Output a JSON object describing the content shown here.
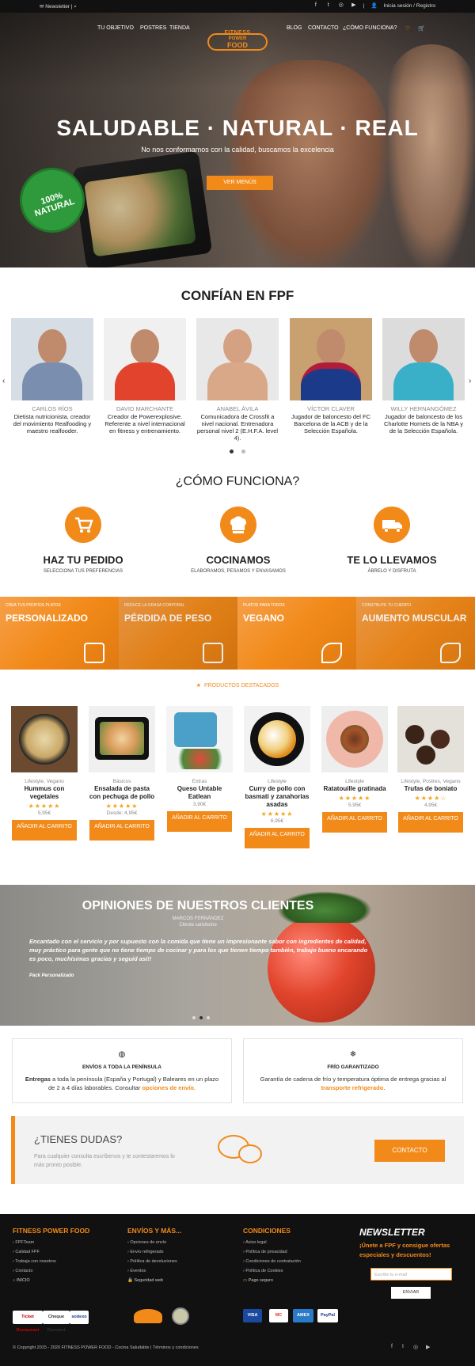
{
  "topbar": {
    "newsletter": "Newsletter",
    "account": "Inicia sesión / Registro",
    "social": [
      "f",
      "t",
      "ig",
      "yt"
    ]
  },
  "nav": {
    "left": [
      "TU OBJETIVO",
      "POSTRES",
      "TIENDA"
    ],
    "right": [
      "BLOG",
      "CONTACTO",
      "¿CÓMO FUNCIONA?"
    ],
    "logo_line1": "FITNESS",
    "logo_line2": "POWER",
    "logo_line3": "FOOD"
  },
  "hero": {
    "title": "SALUDABLE · NATURAL · REAL",
    "subtitle": "No nos conformamos con la calidad, buscamos la excelencia",
    "button": "VER MENÚS",
    "seal": "100% NATURAL"
  },
  "confian": {
    "title": "CONFÍAN EN FPF",
    "people": [
      {
        "name": "CARLOS RÍOS",
        "desc": "Dietista nutricionista, creador del movimiento Realfooding y maestro realfooder."
      },
      {
        "name": "DAVID MARCHANTE",
        "desc": "Creador de Powerexplosive. Referente a nivel internacional en fitness y entrenamiento."
      },
      {
        "name": "ANABEL ÁVILA",
        "desc": "Comunicadora de Crossfit a nivel nacional. Entrenadora personal nivel 2 (E.H.F.A. level 4)."
      },
      {
        "name": "VÍCTOR CLAVER",
        "desc": "Jugador de baloncesto del FC Barcelona de la ACB y de la Selección Española."
      },
      {
        "name": "WILLY HERNANGÓMEZ",
        "desc": "Jugador de baloncesto de los Charlotte Hornets de la NBA y de la Selección Española."
      }
    ]
  },
  "como": {
    "title": "¿CÓMO FUNCIONA?",
    "steps": [
      {
        "title": "HAZ TU PEDIDO",
        "sub": "SELECCIONA TUS PREFERENCIAS",
        "icon": "cart-icon"
      },
      {
        "title": "COCINAMOS",
        "sub": "ELABORAMOS, PESAMOS Y ENVASAMOS",
        "icon": "chef-hat-icon"
      },
      {
        "title": "TE LO LLEVAMOS",
        "sub": "ÁBRELO Y DISFRUTA",
        "icon": "truck-icon"
      }
    ]
  },
  "banners": [
    {
      "small": "CREA TUS PROPIOS PLATOS",
      "big": "PERSONALIZADO"
    },
    {
      "small": "REDUCE LA GRASA CORPORAL",
      "big": "PÉRDIDA DE PESO"
    },
    {
      "small": "PLATOS PARA TODOS",
      "big": "VEGANO"
    },
    {
      "small": "CONSTRUYE TU CUERPO",
      "big": "AUMENTO MUSCULAR"
    }
  ],
  "productos": {
    "title": "PRODUCTOS DESTACADOS",
    "items": [
      {
        "cat": "Lifestyle, Vegano",
        "name": "Hummus con vegetales",
        "stars": "★★★★★",
        "price": "5,95€",
        "cart": "AÑADIR AL CARRITO"
      },
      {
        "cat": "Básicos",
        "name": "Ensalada de pasta con pechuga de pollo",
        "stars": "★★★★★",
        "price": "Desde: 4,95€",
        "cart": "AÑADIR AL CARRITO"
      },
      {
        "cat": "Extras",
        "name": "Queso Untable Eatlean",
        "stars": "",
        "price": "3,90€",
        "cart": "AÑADIR AL CARRITO"
      },
      {
        "cat": "Lifestyle",
        "name": "Curry de pollo con basmati y zanahorias asadas",
        "stars": "★★★★★",
        "price": "6,95€",
        "cart": "AÑADIR AL CARRITO"
      },
      {
        "cat": "Lifestyle",
        "name": "Ratatouille gratinada",
        "stars": "★★★★★",
        "price": "5,95€",
        "cart": "AÑADIR AL CARRITO"
      },
      {
        "cat": "Lifestyle, Postres, Vegano",
        "name": "Trufas de boniato",
        "stars": "★★★★☆",
        "price": "4,95€",
        "cart": "AÑADIR AL CARRITO"
      }
    ]
  },
  "opiniones": {
    "title": "OPINIONES DE NUESTROS CLIENTES",
    "author": "MARCOS FERNÁNDEZ",
    "role": "Cliente satisfecho",
    "quote": "Encantado con el servicio y por supuesto con la comida que tiene un impresionante sabor con ingredientes de calidad, muy práctico para gente que no tiene tiempo de cocinar y para los que tienen tiempo también, trabajo bueno encarando es poco, muchísimas gracias y seguid así!!",
    "pack": "Pack Personalizado"
  },
  "info": [
    {
      "icon": "globe-icon",
      "title": "ENVÍOS A TODA LA PENÍNSULA",
      "pre_bold": "Entregas",
      "text": " a toda la península (España y Portugal) y Baleares en un plazo de 2 a 4 días laborables. Consultar ",
      "link": "opciones de envío",
      "post": "."
    },
    {
      "icon": "snowflake-icon",
      "title": "FRÍO GARANTIZADO",
      "pre_bold": "",
      "text": "Garantía de cadena de frío y temperatura óptima de entrega gracias al ",
      "link": "transporte refrigerado",
      "post": "."
    }
  ],
  "dudas": {
    "title": "¿TIENES DUDAS?",
    "desc": "Para cualquier consulta escríbenos y te contestaremos lo más pronto posible.",
    "button": "CONTACTO"
  },
  "footer": {
    "cols": [
      {
        "title": "FITNESS POWER FOOD",
        "items": [
          "FPFTeam",
          "Calidad FPF",
          "Trabaja con nosotros",
          "Contacto"
        ],
        "sub": "INICIO"
      },
      {
        "title": "ENVÍOS Y MÁS...",
        "items": [
          "Opciones de envío",
          "Envío refrigerado",
          "Política de devoluciones",
          "Eventos"
        ],
        "sub": "Seguridad web"
      },
      {
        "title": "CONDICIONES",
        "items": [
          "Aviso legal",
          "Política de privacidad",
          "Condiciones de contratación",
          "Política de Cookies"
        ],
        "sub": "Pago seguro"
      }
    ],
    "newsletter_title": "NEWSLETTER",
    "newsletter_desc": "¡Únete a FPF y consigue ofertas especiales y descuentos!",
    "newsletter_placeholder": "Escribe tu e-mail",
    "newsletter_button": "ENVIAR",
    "badges": [
      "Ticket Restaurant",
      "Cheque Gourmet",
      "sodexo"
    ],
    "cards": [
      "VISA",
      "MC",
      "AMEX",
      "PayPal"
    ],
    "copyright": "© Copyright 2015 - 2020 FITNESS POWER FOOD - Cocina Saludable | Términos y condiciones"
  }
}
